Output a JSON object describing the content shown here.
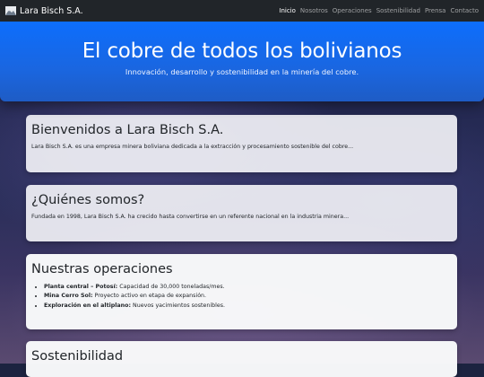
{
  "navbar": {
    "brand": "Lara Bisch S.A.",
    "brand_icon": "mountain-logo-icon",
    "links": [
      "Inicio",
      "Nosotros",
      "Operaciones",
      "Sostenibilidad",
      "Prensa",
      "Contacto"
    ],
    "active": "Inicio"
  },
  "hero": {
    "title": "El cobre de todos los bolivianos",
    "subtitle": "Innovación, desarrollo y sostenibilidad en la minería del cobre."
  },
  "sections": {
    "welcome": {
      "title": "Bienvenidos a Lara Bisch S.A.",
      "text": "Lara Bisch S.A. es una empresa minera boliviana dedicada a la extracción y procesamiento sostenible del cobre..."
    },
    "about": {
      "title": "¿Quiénes somos?",
      "text": "Fundada en 1998, Lara Bisch S.A. ha crecido hasta convertirse en un referente nacional en la industria minera..."
    },
    "operations": {
      "title": "Nuestras operaciones",
      "items": [
        {
          "name": "Planta central – Potosí:",
          "desc": "Capacidad de 30,000 toneladas/mes."
        },
        {
          "name": "Mina Cerro Sol:",
          "desc": "Proyecto activo en etapa de expansión."
        },
        {
          "name": "Exploración en el altiplano:",
          "desc": "Nuevos yacimientos sostenibles."
        }
      ]
    },
    "sustainability": {
      "title": "Sostenibilidad"
    }
  },
  "colors": {
    "navbar": "#212529",
    "hero": "#0d6efd",
    "card": "#f0f0f5"
  }
}
